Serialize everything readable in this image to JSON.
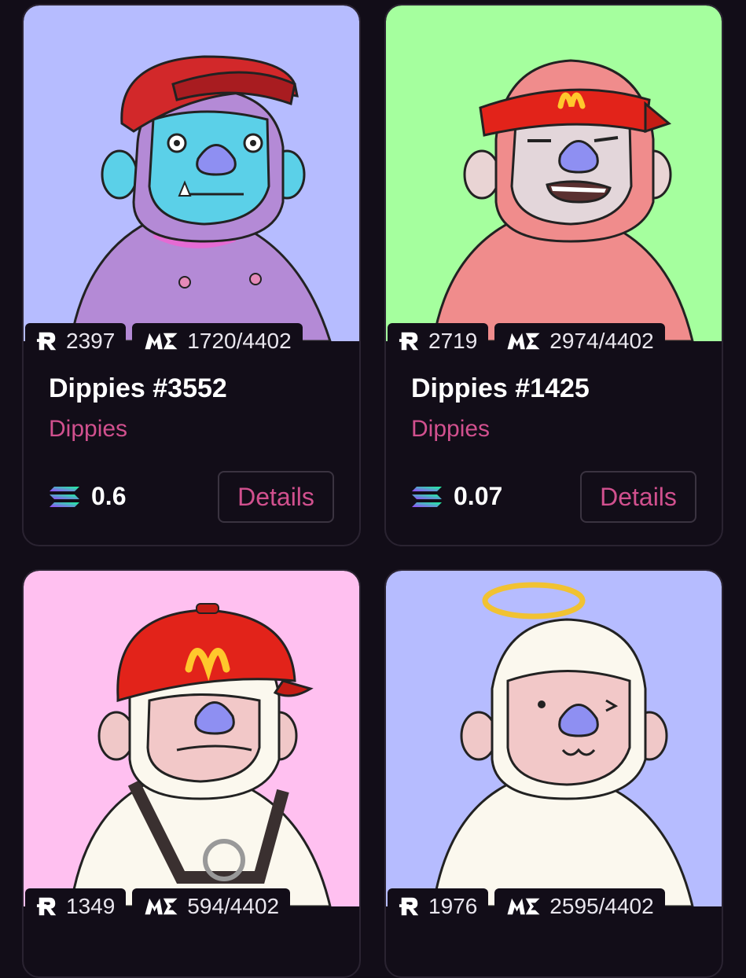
{
  "cards": [
    {
      "title": "Dippies #3552",
      "collection": "Dippies",
      "rank_r": "2397",
      "rank_me": "1720/4402",
      "price": "0.6",
      "details_label": "Details",
      "bg_color": "#b6bcff",
      "character": "purple ape with blue face and red cap"
    },
    {
      "title": "Dippies #1425",
      "collection": "Dippies",
      "rank_r": "2719",
      "rank_me": "2974/4402",
      "price": "0.07",
      "details_label": "Details",
      "bg_color": "#a5ff9e",
      "character": "pink ape with red M visor"
    },
    {
      "rank_r": "1349",
      "rank_me": "594/4402",
      "bg_color": "#ffc0f0",
      "character": "white ape with red M cap and harness"
    },
    {
      "rank_r": "1976",
      "rank_me": "2595/4402",
      "bg_color": "#b6bcff",
      "character": "white ape with golden halo"
    }
  ],
  "icons": {
    "rarity": "r-rank-icon",
    "magic_eden": "magic-eden-icon",
    "currency": "solana-icon"
  },
  "colors": {
    "page_bg": "#120d18",
    "accent": "#d1508e"
  }
}
